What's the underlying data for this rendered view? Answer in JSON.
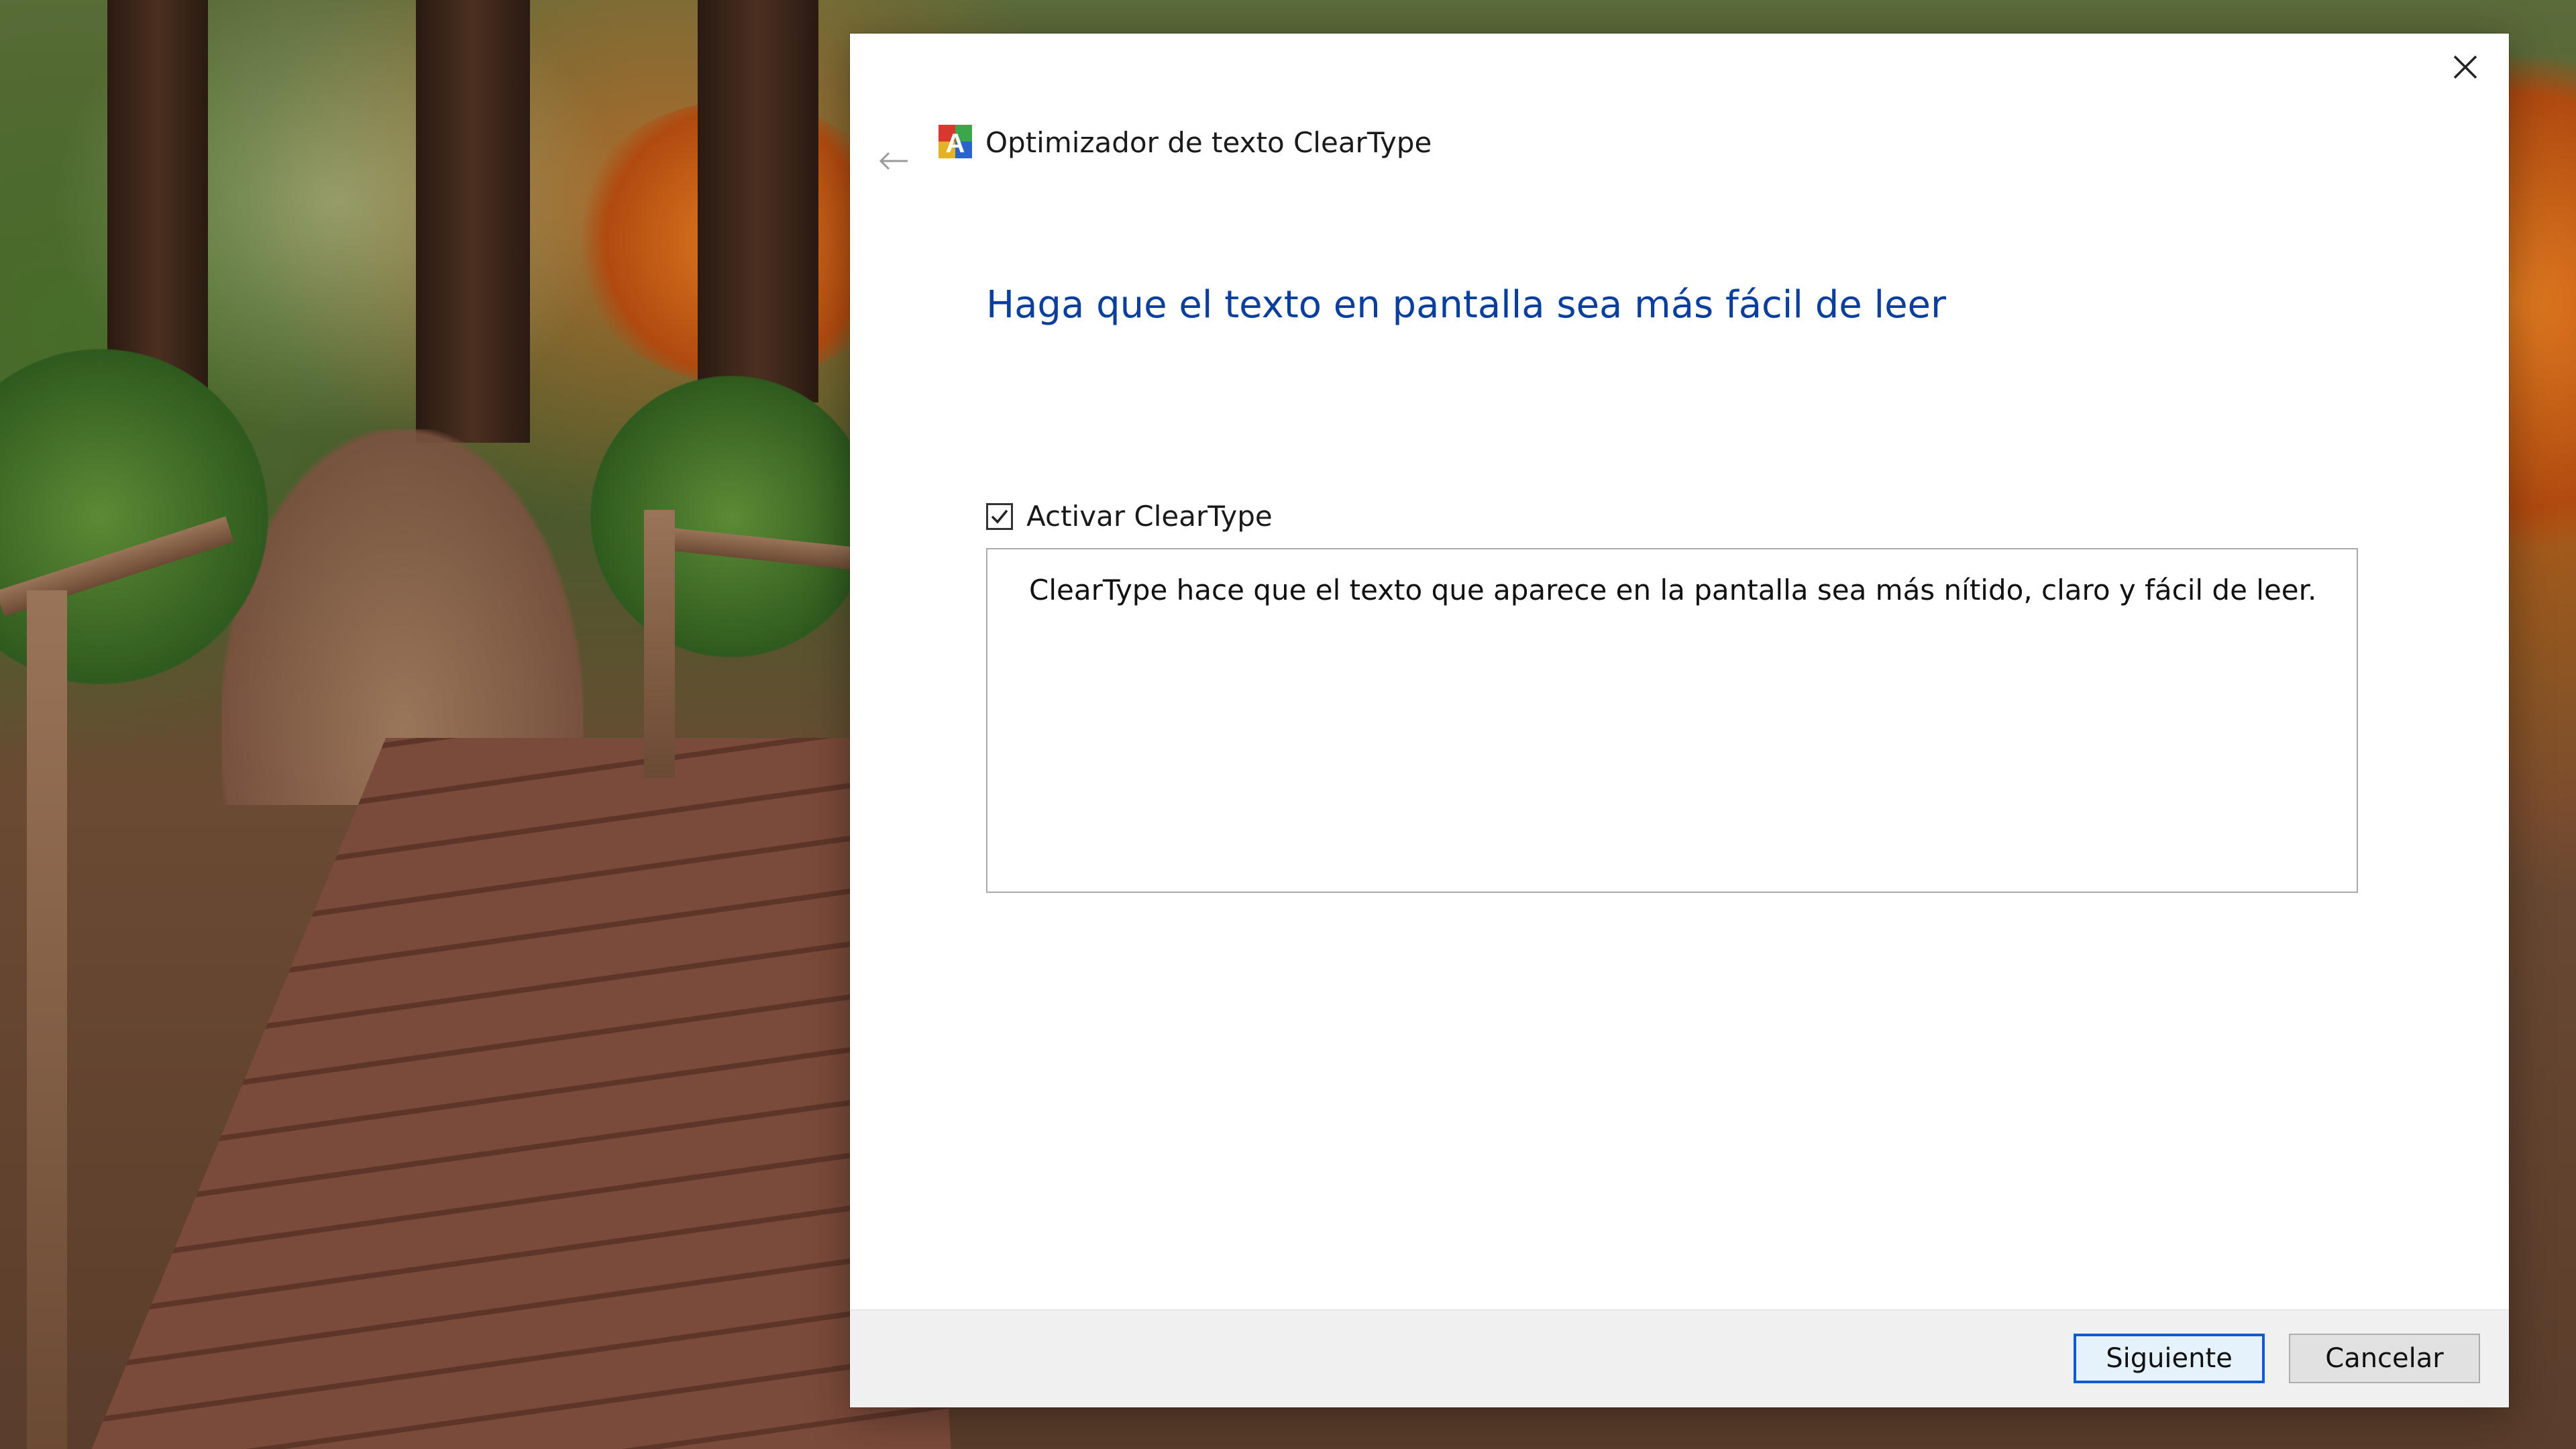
{
  "window": {
    "title": "Optimizador de texto ClearType",
    "back_icon": "back-arrow-icon",
    "close_icon": "close-icon",
    "app_icon": "cleartype-icon"
  },
  "main": {
    "heading": "Haga que el texto en pantalla sea más fácil de leer",
    "checkbox": {
      "label": "Activar ClearType",
      "checked": true
    },
    "description": "ClearType hace que el texto que aparece en la pantalla sea más nítido, claro y fácil de leer."
  },
  "footer": {
    "next_label": "Siguiente",
    "cancel_label": "Cancelar"
  },
  "colors": {
    "heading": "#0b3f9e",
    "primary_button_border": "#0a5bd3"
  }
}
